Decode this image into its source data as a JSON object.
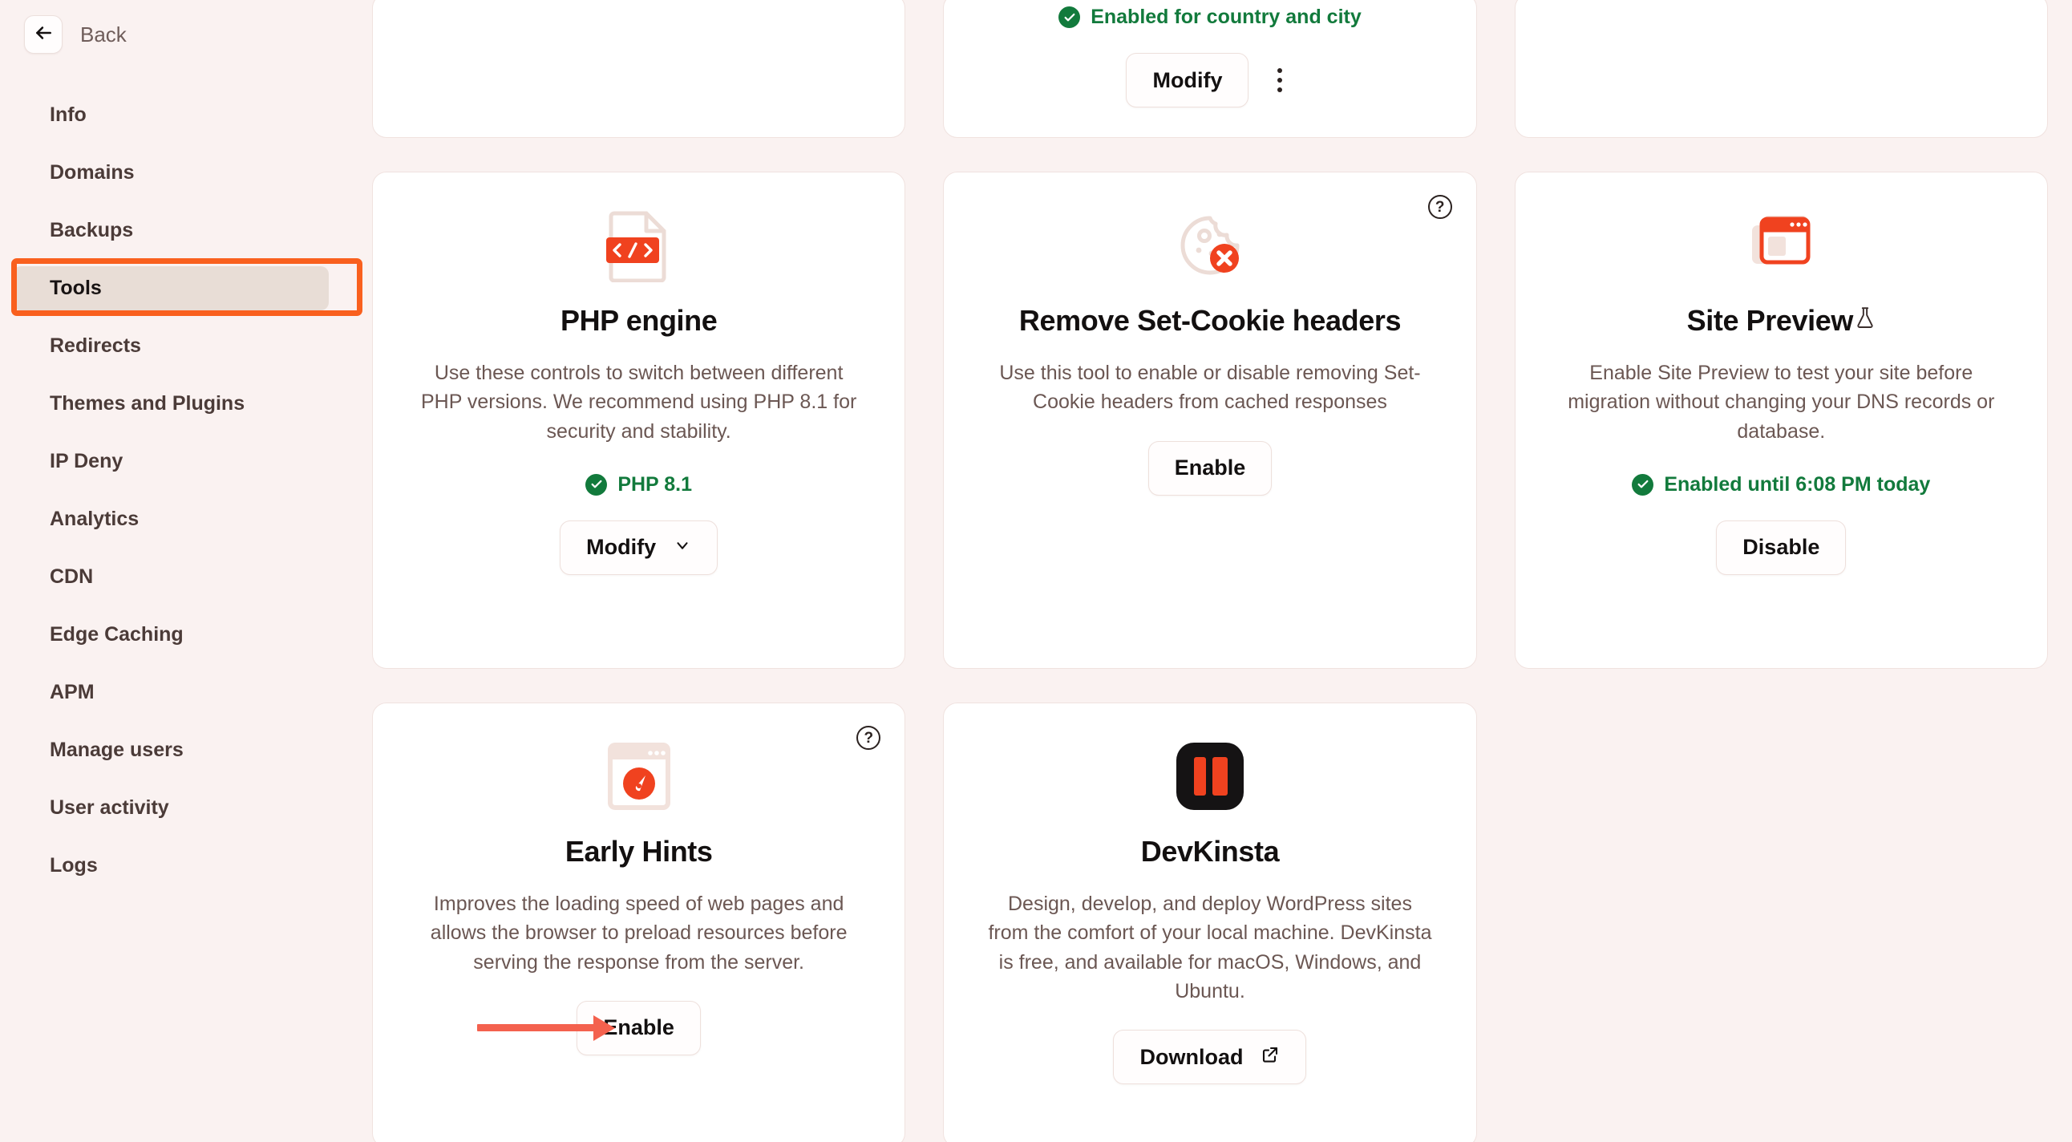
{
  "colors": {
    "background": "#faf2f1",
    "card_bg": "#ffffff",
    "accent_orange": "#f9601e",
    "annotation_arrow": "#f4614e",
    "status_green": "#127a3c",
    "selected_nav_bg": "#e8ddd6"
  },
  "sidebar": {
    "back_label": "Back",
    "back_icon": "arrow-left-icon",
    "items": [
      {
        "label": "Info",
        "selected": false
      },
      {
        "label": "Domains",
        "selected": false
      },
      {
        "label": "Backups",
        "selected": false
      },
      {
        "label": "Tools",
        "selected": true
      },
      {
        "label": "Redirects",
        "selected": false
      },
      {
        "label": "Themes and Plugins",
        "selected": false
      },
      {
        "label": "IP Deny",
        "selected": false
      },
      {
        "label": "Analytics",
        "selected": false
      },
      {
        "label": "CDN",
        "selected": false
      },
      {
        "label": "Edge Caching",
        "selected": false
      },
      {
        "label": "APM",
        "selected": false
      },
      {
        "label": "Manage users",
        "selected": false
      },
      {
        "label": "User activity",
        "selected": false
      },
      {
        "label": "Logs",
        "selected": false
      }
    ]
  },
  "row_top": {
    "card_left": {
      "has_content": false
    },
    "card_middle": {
      "status": "Enabled for country and city",
      "status_icon": "check-circle-icon",
      "modify_label": "Modify",
      "kebab_label": "more-options"
    },
    "card_right": {
      "has_content": false
    }
  },
  "cards": {
    "php_engine": {
      "icon": "code-file-icon",
      "title": "PHP engine",
      "description": "Use these controls to switch between different PHP versions. We recommend using PHP 8.1 for security and stability.",
      "status": "PHP 8.1",
      "status_icon": "check-circle-icon",
      "button": "Modify",
      "button_icon": "chevron-down-icon"
    },
    "set_cookie": {
      "icon": "cookie-blocked-icon",
      "help_icon": "question-mark-circle-icon",
      "title": "Remove Set-Cookie headers",
      "description": "Use this tool to enable or disable removing Set-Cookie headers from cached responses",
      "button": "Enable"
    },
    "site_preview": {
      "icon": "browser-windows-icon",
      "title": "Site Preview",
      "title_badge": "beta-flask-icon",
      "description": "Enable Site Preview to test your site before migration without changing your DNS records or database.",
      "status": "Enabled until 6:08 PM today",
      "status_icon": "check-circle-icon",
      "button": "Disable"
    },
    "early_hints": {
      "icon": "browser-speed-icon",
      "help_icon": "question-mark-circle-icon",
      "title": "Early Hints",
      "description": "Improves the loading speed of web pages and allows the browser to preload resources before serving the response from the server.",
      "button": "Enable",
      "annotation": "arrow-pointing-to-enable"
    },
    "devkinsta": {
      "icon": "devkinsta-logo-icon",
      "title": "DevKinsta",
      "description": "Design, develop, and deploy WordPress sites from the comfort of your local machine. DevKinsta is free, and available for macOS, Windows, and Ubuntu.",
      "button": "Download",
      "button_icon": "external-link-icon"
    }
  }
}
